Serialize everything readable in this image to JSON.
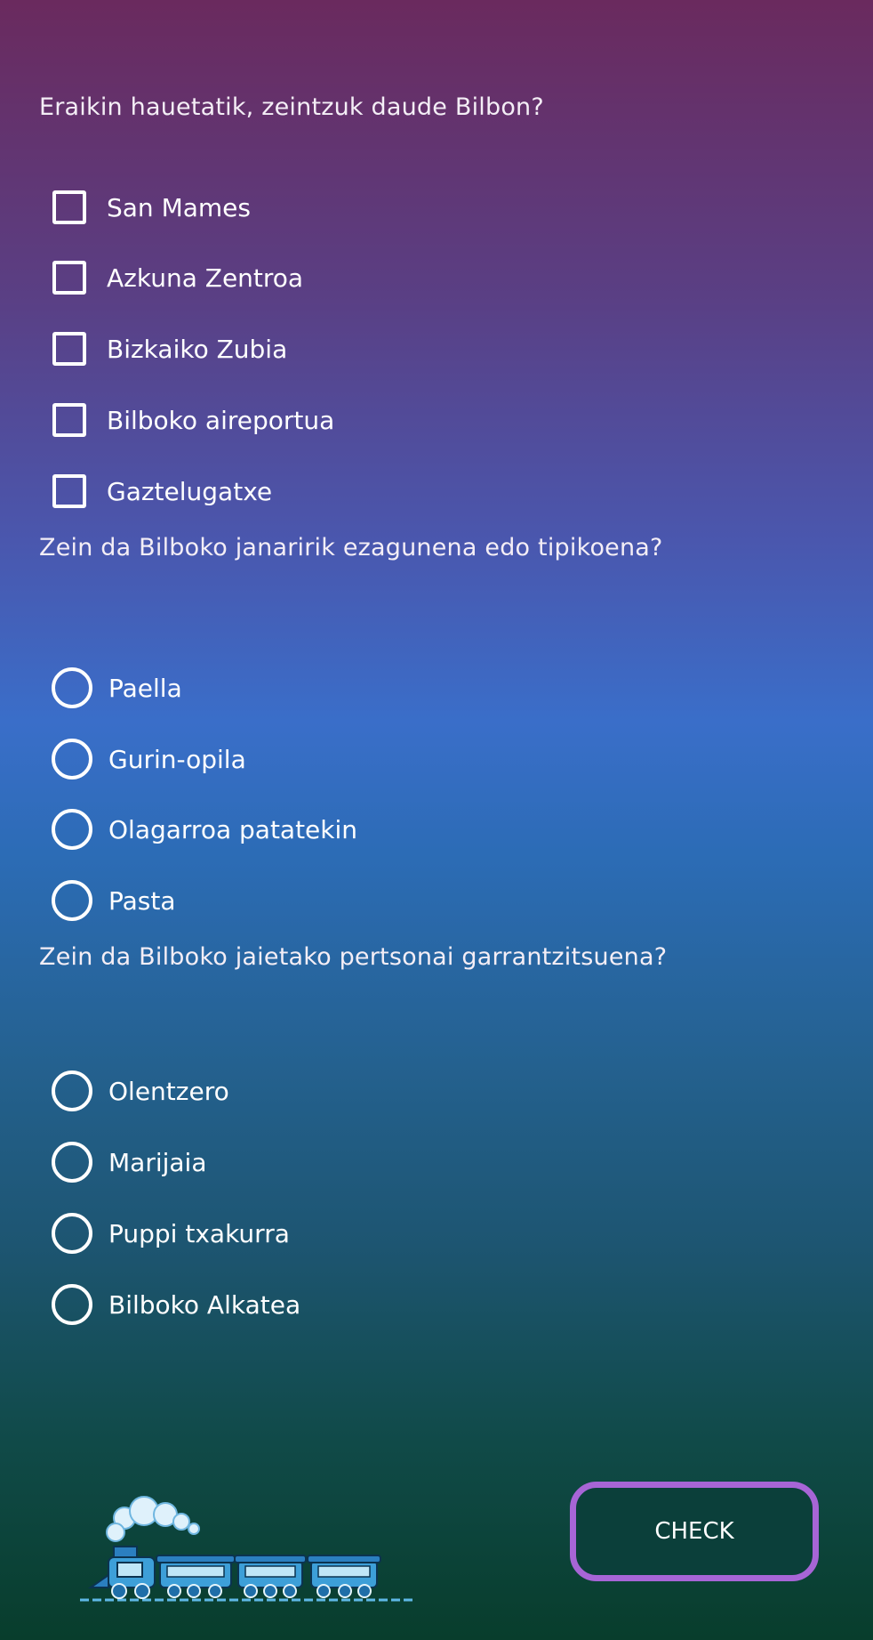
{
  "questions": [
    {
      "text": "Eraikin hauetatik, zeintzuk daude Bilbon?",
      "type": "checkbox",
      "options": [
        "San Mames",
        "Azkuna Zentroa",
        "Bizkaiko Zubia",
        "Bilboko aireportua",
        "Gaztelugatxe"
      ]
    },
    {
      "text": "Zein da Bilboko janaririk ezagunena edo tipikoena?",
      "type": "radio",
      "options": [
        "Paella",
        "Gurin-opila",
        "Olagarroa patatekin",
        "Pasta"
      ]
    },
    {
      "text": "Zein da Bilboko jaietako pertsonai garrantzitsuena?",
      "type": "radio",
      "options": [
        "Olentzero",
        "Marijaia",
        "Puppi txakurra",
        "Bilboko Alkatea"
      ]
    }
  ],
  "check_button": {
    "label": "CHECK"
  },
  "colors": {
    "button_border": "#a765d6",
    "button_fill": "#0b3f3a",
    "gradient_top": "#6a2a5e",
    "gradient_mid": "#3a6ec9",
    "gradient_bottom": "#083d2c"
  },
  "icons": {
    "train": "train-icon"
  }
}
